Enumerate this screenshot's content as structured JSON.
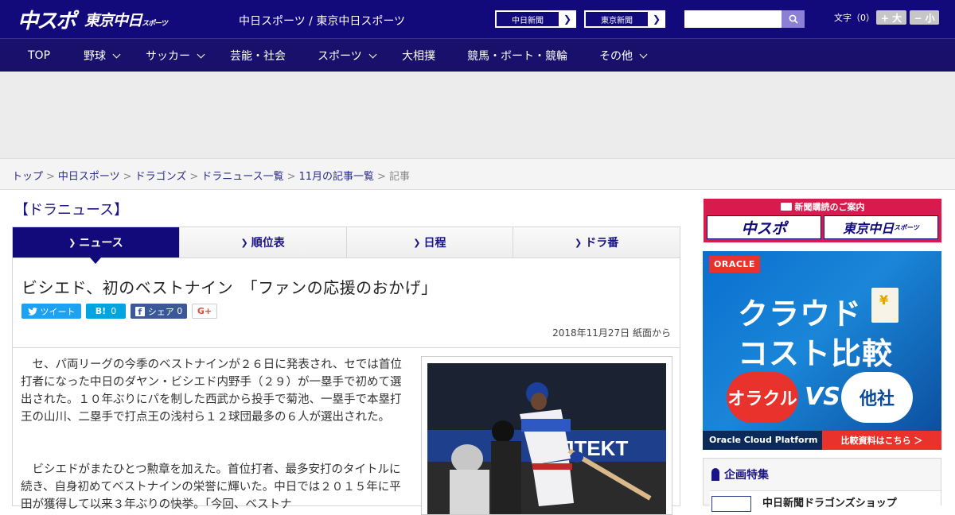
{
  "header": {
    "logo_main": "中スポ",
    "logo_tokyo": "東京中日",
    "logo_tokyo_small": "スポーツ",
    "site_name": "中日スポーツ / 東京中日スポーツ",
    "link_chunichi": "中日新聞",
    "link_tokyo": "東京新聞",
    "search_placeholder": "",
    "font_size_label": "文字（0）",
    "font_bigger": "+ 大",
    "font_smaller": "− 小"
  },
  "nav": {
    "items": [
      {
        "label": "TOP",
        "dropdown": false
      },
      {
        "label": "野球",
        "dropdown": true
      },
      {
        "label": "サッカー",
        "dropdown": true
      },
      {
        "label": "芸能・社会",
        "dropdown": false
      },
      {
        "label": "スポーツ",
        "dropdown": true
      },
      {
        "label": "大相撲",
        "dropdown": false
      },
      {
        "label": "競馬・ボート・競輪",
        "dropdown": false
      },
      {
        "label": "その他",
        "dropdown": true
      }
    ]
  },
  "breadcrumb": {
    "items": [
      "トップ",
      "中日スポーツ",
      "ドラゴンズ",
      "ドラニュース一覧",
      "11月の記事一覧"
    ],
    "current": "記事",
    "separator": ">"
  },
  "section_title": "【ドラニュース】",
  "tabs": [
    {
      "label": "ニュース",
      "active": true
    },
    {
      "label": "順位表",
      "active": false
    },
    {
      "label": "日程",
      "active": false
    },
    {
      "label": "ドラ番",
      "active": false
    }
  ],
  "article": {
    "headline": "ビシエド、初のベストナイン　「ファンの応援のおかげ」",
    "share": {
      "tweet": "ツイート",
      "hatena": "B!",
      "hatena_count": "0",
      "facebook": "シェア",
      "facebook_count": "0",
      "gplus": "G+"
    },
    "date": "2018年11月27日 紙面から",
    "paragraphs": [
      "セ、パ両リーグの今季のベストナインが２６日に発表され、セでは首位打者になった中日のダヤン・ビシエド内野手（２９）が一塁手で初めて選出された。１０年ぶりにパを制した西武から投手で菊池、一塁手で本塁打王の山川、二塁手で打点王の浅村ら１２球団最多の６人が選出された。",
      "ビシエドがまたひとつ勲章を加えた。首位打者、最多安打のタイトルに続き、自身初めてベストナインの栄誉に輝いた。中日では２０１５年に平田が獲得して以来３年ぶりの快挙。「今回、ベストナ"
    ],
    "photo_banner_text": "JTEKT"
  },
  "sidebar": {
    "subscribe_title": "新聞購読のご案内",
    "subscribe_left": "中スポ",
    "subscribe_right": "東京中日",
    "subscribe_right_small": "スポーツ",
    "ad": {
      "brand": "ORACLE",
      "line1": "クラウド",
      "line2": "コスト比較",
      "left_bubble": "オラクル",
      "vs": "VS",
      "right_bubble": "他社",
      "footer_left": "Oracle Cloud Platform",
      "footer_right": "比較資料はこちら ＞",
      "yen": "¥"
    },
    "feature_title": "企画特集",
    "feature_item": "中日新聞ドラゴンズショップ"
  }
}
